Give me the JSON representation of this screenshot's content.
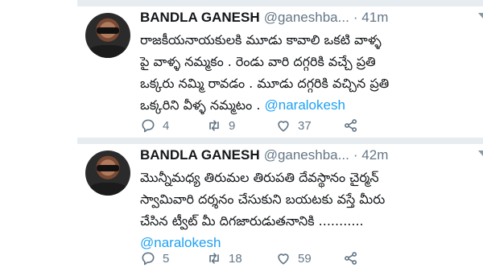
{
  "tweets": [
    {
      "author_name": "BANDLA GANESH",
      "handle": "@ganeshba...",
      "time": "41m",
      "lines": [
        "రాజకీయనాయకులకి మూడు కావాలి ఒకటి వాళ్ళ",
        "పై వాళ్ళ నమ్మకం . రెండు వారి దగ్గరికి వచ్చే ప్రతి",
        "ఒక్కరు నమ్మి రావడం . మూడు దగ్గరికి వచ్చిన ప్రతి",
        "ఒక్కరిని వీళ్ళ నమ్మటం ."
      ],
      "mention": "@naralokesh",
      "replies": "4",
      "retweets": "9",
      "likes": "37"
    },
    {
      "author_name": "BANDLA GANESH",
      "handle": "@ganeshba...",
      "time": "42m",
      "lines": [
        "మొన్నీమధ్య తిరుమల తిరుపతి దేవస్థానం చైర్మన్",
        "స్వామివారి దర్శనం చేసుకుని బయటకు వస్తే మీరు",
        "చేసిన ట్వీట్ మీ దిగజారుడుతనానికి ..........."
      ],
      "mention": "@naralokesh",
      "replies": "5",
      "retweets": "18",
      "likes": "59"
    }
  ],
  "icons": {
    "reply": "reply-icon",
    "retweet": "retweet-icon",
    "like": "heart-icon",
    "share": "share-icon"
  },
  "colors": {
    "link": "#1da1f2",
    "muted": "#657786",
    "separator": "#e6ecf0"
  }
}
